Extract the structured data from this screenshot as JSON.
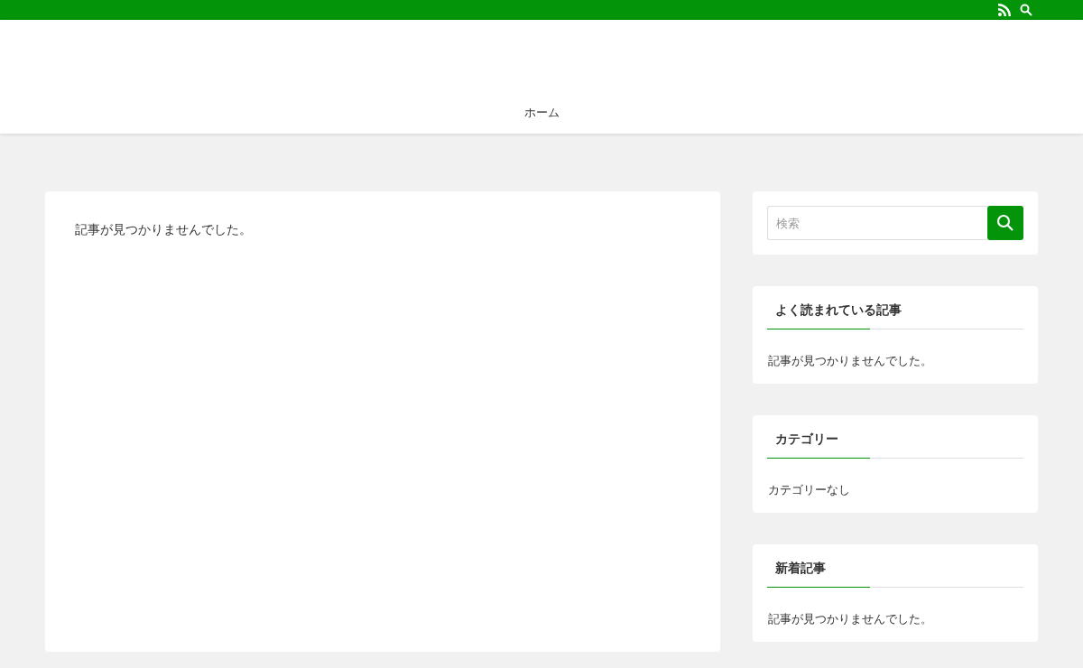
{
  "header": {
    "nav": [
      {
        "label": "ホーム"
      }
    ]
  },
  "main": {
    "message": "記事が見つかりませんでした。"
  },
  "sidebar": {
    "search": {
      "placeholder": "検索"
    },
    "widgets": [
      {
        "title": "よく読まれている記事",
        "text": "記事が見つかりませんでした。"
      },
      {
        "title": "カテゴリー",
        "text": "カテゴリーなし"
      },
      {
        "title": "新着記事",
        "text": "記事が見つかりませんでした。"
      }
    ]
  }
}
